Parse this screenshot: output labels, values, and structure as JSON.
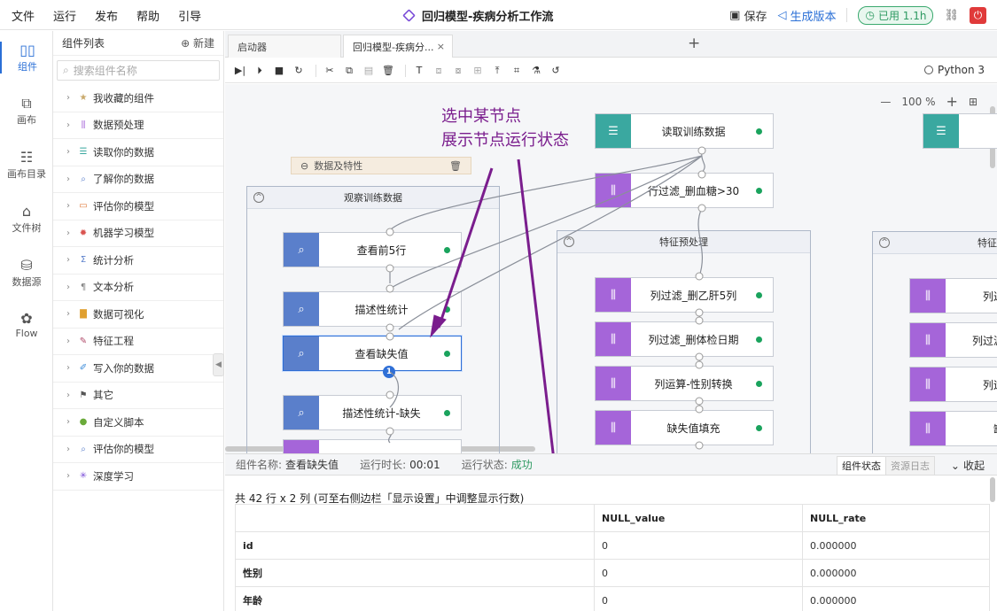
{
  "menu": [
    "文件",
    "运行",
    "发布",
    "帮助",
    "引导"
  ],
  "app_title": "回归模型-疾病分析工作流",
  "actions": {
    "save": "保存",
    "publish": "生成版本",
    "used": "已用 1.1h"
  },
  "rail": [
    {
      "label": "组件",
      "icon": "component-icon"
    },
    {
      "label": "画布",
      "icon": "canvas-icon"
    },
    {
      "label": "画布目录",
      "icon": "canvas-directory-icon"
    },
    {
      "label": "文件树",
      "icon": "file-tree-icon"
    },
    {
      "label": "数据源",
      "icon": "datasource-icon"
    },
    {
      "label": "Flow",
      "icon": "flow-icon"
    }
  ],
  "panel": {
    "title": "组件列表",
    "new": "新建",
    "search_placeholder": "搜索组件名称",
    "items": [
      {
        "label": "我收藏的组件",
        "color": "#c9a96b",
        "icon": "★"
      },
      {
        "label": "数据预处理",
        "color": "#a565d9",
        "icon": "⫼"
      },
      {
        "label": "读取你的数据",
        "color": "#3aa8a0",
        "icon": "☰"
      },
      {
        "label": "了解你的数据",
        "color": "#5a7fcb",
        "icon": "⌕"
      },
      {
        "label": "评估你的模型",
        "color": "#e07a3a",
        "icon": "▭"
      },
      {
        "label": "机器学习模型",
        "color": "#d9534f",
        "icon": "✹"
      },
      {
        "label": "统计分析",
        "color": "#5a7fcb",
        "icon": "Σ"
      },
      {
        "label": "文本分析",
        "color": "#888888",
        "icon": "¶"
      },
      {
        "label": "数据可视化",
        "color": "#e0a030",
        "icon": "▇"
      },
      {
        "label": "特征工程",
        "color": "#b04a6a",
        "icon": "✎"
      },
      {
        "label": "写入你的数据",
        "color": "#3a8ad9",
        "icon": "✐"
      },
      {
        "label": "其它",
        "color": "#555555",
        "icon": "⚑"
      },
      {
        "label": "自定义脚本",
        "color": "#6aaa3a",
        "icon": "●"
      },
      {
        "label": "评估你的模型",
        "color": "#5a7fcb",
        "icon": "⌕"
      },
      {
        "label": "深度学习",
        "color": "#7b4ed8",
        "icon": "✳"
      }
    ]
  },
  "tabs": [
    "启动器",
    "回归模型-疾病分..."
  ],
  "kernel": "Python 3",
  "zoom": "100 %",
  "canvas": {
    "group_bar": "数据及特性",
    "groups": [
      "观察训练数据",
      "特征预处理",
      "特征"
    ],
    "nodes": {
      "n1": "读取训练数据",
      "n2": "行过滤_删血糖>30",
      "n3": "查看前5行",
      "n4": "描述性统计",
      "n5": "查看缺失值",
      "n6": "描述性统计-缺失",
      "n7": "列过滤_删乙肝5列",
      "n8": "列过滤_删体检日期",
      "n9": "列运算-性别转换",
      "n10": "缺失值填充",
      "r1": "列过",
      "r2": "列过滤",
      "r3": "列运",
      "r4": "缺"
    },
    "badge": "1",
    "annotation": [
      "选中某节点",
      "展示节点运行状态"
    ]
  },
  "info": {
    "name_key": "组件名称:",
    "name_val": "查看缺失值",
    "time_key": "运行时长:",
    "time_val": "00:01",
    "status_key": "运行状态:",
    "status_val": "成功",
    "seg_on": "组件状态",
    "seg_off": "资源日志",
    "fold": "收起"
  },
  "result": {
    "summary": "共 42 行 x 2 列 (可至右侧边栏「显示设置」中调整显示行数)",
    "columns": [
      "",
      "NULL_value",
      "NULL_rate"
    ],
    "rows": [
      [
        "id",
        "0",
        "0.000000"
      ],
      [
        "性别",
        "0",
        "0.000000"
      ],
      [
        "年龄",
        "0",
        "0.000000"
      ]
    ]
  },
  "colors": {
    "accent": "#2a6fd6",
    "success": "#1aa35d",
    "annotation": "#7a1d8d"
  }
}
